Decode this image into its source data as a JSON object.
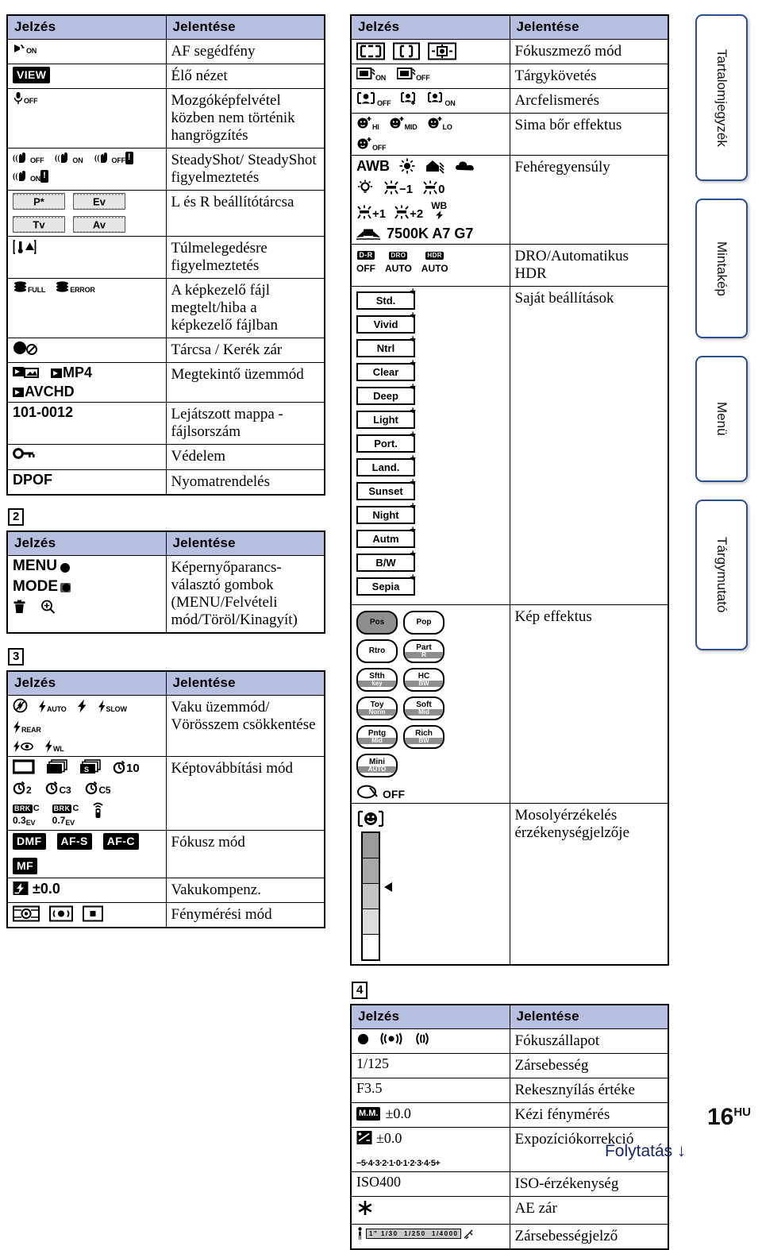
{
  "page": {
    "number": "16",
    "locale_suffix": "HU",
    "continue_label": "Folytatás",
    "continue_arrow": "↓"
  },
  "side_tabs": [
    {
      "label": "Tartalomjegyzék",
      "name": "tab-table-of-contents"
    },
    {
      "label": "Mintakép",
      "name": "tab-sample-photo"
    },
    {
      "label": "Menü",
      "name": "tab-menu"
    },
    {
      "label": "Tárgymutató",
      "name": "tab-index"
    }
  ],
  "column_headers": {
    "symbol": "Jelzés",
    "meaning": "Jelentése"
  },
  "sections": [
    {
      "id": "1",
      "badge_visible": false,
      "column": "left",
      "rows": [
        {
          "symbols": [
            "AF illuminator ON"
          ],
          "meaning": "AF segédfény"
        },
        {
          "symbols": [
            "VIEW"
          ],
          "meaning": "Élő nézet"
        },
        {
          "symbols": [
            "microphone OFF"
          ],
          "meaning": "Mozgóképfelvétel közben nem történik hangrögzítés"
        },
        {
          "symbols": [
            "SteadyShot OFF",
            "SteadyShot ON",
            "SteadyShot OFF warning",
            "SteadyShot ON warning"
          ],
          "meaning": "SteadyShot/ SteadyShot figyelmeztetés"
        },
        {
          "symbols": [
            "P*",
            "Ev",
            "Tv",
            "Av"
          ],
          "meaning": "L és R beállítótárcsa"
        },
        {
          "symbols": [
            "overheat warning"
          ],
          "meaning": "Túlmelegedésre figyelmeztetés"
        },
        {
          "symbols": [
            "database FULL",
            "database ERROR"
          ],
          "meaning": "A képkezelő fájl megtelt/hiba a képkezelő fájlban"
        },
        {
          "symbols": [
            "dial wheel lock"
          ],
          "meaning": "Tárcsa / Kerék zár"
        },
        {
          "symbols": [
            "playback still",
            "playback MP4",
            "playback AVCHD"
          ],
          "meaning": "Megtekintő üzemmód"
        },
        {
          "symbols": [
            "101-0012"
          ],
          "meaning": "Lejátszott mappa - fájlsorszám"
        },
        {
          "symbols": [
            "protect key"
          ],
          "meaning": "Védelem"
        },
        {
          "symbols": [
            "DPOF"
          ],
          "meaning": "Nyomatrendelés"
        }
      ]
    },
    {
      "id": "2",
      "badge_visible": true,
      "column": "left",
      "rows": [
        {
          "symbols": [
            "MENU",
            "MODE",
            "delete",
            "zoom in"
          ],
          "meaning": "Képernyőparancs-választó gombok (MENU/Felvételi mód/Töröl/Kinagyít)"
        }
      ]
    },
    {
      "id": "3",
      "badge_visible": true,
      "column": "left",
      "rows": [
        {
          "symbols": [
            "flash off",
            "flash AUTO",
            "flash fill",
            "flash SLOW",
            "flash REAR",
            "red-eye reduction",
            "flash WL"
          ],
          "meaning": "Vaku üzemmód/ Vörösszem csökkentése"
        },
        {
          "symbols": [
            "single shooting",
            "continuous",
            "speed priority S",
            "self-timer 10",
            "self-timer 2",
            "self-timer C3",
            "self-timer C5",
            "BRK C 0.3EV",
            "BRK C 0.7EV",
            "remote commander"
          ],
          "meaning": "Képtovábbítási mód"
        },
        {
          "symbols": [
            "DMF",
            "AF-S",
            "AF-C",
            "MF"
          ],
          "meaning": "Fókusz mód"
        },
        {
          "symbols": [
            "flash compensation ±0.0"
          ],
          "meaning": "Vakukompenz."
        },
        {
          "symbols": [
            "multi metering",
            "center metering",
            "spot metering"
          ],
          "meaning": "Fénymérési mód"
        }
      ]
    },
    {
      "id": "1r",
      "badge_visible": false,
      "column": "right",
      "rows": [
        {
          "symbols": [
            "wide focus area",
            "zone focus area",
            "flexible spot"
          ],
          "meaning": "Fókuszmező mód"
        },
        {
          "symbols": [
            "object tracking ON",
            "object tracking OFF"
          ],
          "meaning": "Tárgykövetés"
        },
        {
          "symbols": [
            "face detection OFF",
            "face registration",
            "face detection ON"
          ],
          "meaning": "Arcfelismerés"
        },
        {
          "symbols": [
            "soft skin HI",
            "soft skin MID",
            "soft skin LO",
            "soft skin OFF"
          ],
          "meaning": "Sima bőr effektus"
        },
        {
          "symbols": [
            "AWB",
            "daylight",
            "shade",
            "cloudy",
            "incandescent",
            "fluorescent -1",
            "fluorescent 0",
            "fluorescent +1",
            "fluorescent +2",
            "WB flash",
            "custom 7500K A7 G7"
          ],
          "meaning": "Fehéregyensúly"
        },
        {
          "symbols": [
            "D-R OFF",
            "DRO AUTO",
            "HDR AUTO"
          ],
          "meaning": "DRO/Automatikus HDR"
        },
        {
          "symbols": [
            "Std.",
            "Vivid",
            "Ntrl",
            "Clear",
            "Deep",
            "Light",
            "Port.",
            "Land.",
            "Sunset",
            "Night",
            "Autm",
            "B/W",
            "Sepia"
          ],
          "meaning": "Saját beállítások"
        },
        {
          "symbols": [
            "Pos",
            "Pop",
            "Rtro",
            "Part R",
            "Sfth key",
            "HC BW",
            "Toy Norm",
            "Soft Mid",
            "Pntg Mid",
            "Rich BW",
            "Mini AUTO",
            "picture effect OFF"
          ],
          "meaning": "Kép effektus"
        },
        {
          "symbols": [
            "smile detection",
            "smile sensitivity meter"
          ],
          "meaning": "Mosolyérzékelés érzékenységjelzője"
        }
      ]
    },
    {
      "id": "4",
      "badge_visible": true,
      "column": "right",
      "rows": [
        {
          "symbols": [
            "focus locked",
            "focus searching wide",
            "focus searching"
          ],
          "meaning": "Fókuszállapot"
        },
        {
          "symbols": [
            "1/125"
          ],
          "meaning": "Zársebesség"
        },
        {
          "symbols": [
            "F3.5"
          ],
          "meaning": "Rekesznyílás értéke"
        },
        {
          "symbols": [
            "M.M. ±0.0"
          ],
          "meaning": "Kézi fénymérés"
        },
        {
          "symbols": [
            "EV ±0.0",
            "-5·4·3·2·1·0·1·2·3·4·5+"
          ],
          "meaning": "Expozíciókorrekció"
        },
        {
          "symbols": [
            "ISO400"
          ],
          "meaning": "ISO-érzékenység"
        },
        {
          "symbols": [
            "AE lock"
          ],
          "meaning": "AE zár"
        },
        {
          "symbols": [
            "shutter speed scale 1\" 1/30 1/250 1/4000"
          ],
          "meaning": "Zársebességjelző"
        }
      ]
    }
  ],
  "icon_text": {
    "on": "ON",
    "off": "OFF",
    "view": "VIEW",
    "pstar": "P*",
    "ev": "Ev",
    "tv": "Tv",
    "av": "Av",
    "full": "FULL",
    "error": "ERROR",
    "mp4": "MP4",
    "avchd": "AVCHD",
    "folder_file": "101-0012",
    "dpof": "DPOF",
    "menu": "MENU",
    "mode": "MODE",
    "auto": "AUTO",
    "slow": "SLOW",
    "rear": "REAR",
    "wl": "WL",
    "s": "S",
    "t10": "10",
    "t2": "2",
    "c3": "C3",
    "c5": "C5",
    "brk": "BRK",
    "c": "C",
    "ev03": "0.3",
    "ev07": "0.7",
    "evlab": "EV",
    "dmf": "DMF",
    "afs": "AF-S",
    "afc": "AF-C",
    "mf": "MF",
    "pm00": "±0.0",
    "hi": "HI",
    "mid": "MID",
    "lo": "LO",
    "awb": "AWB",
    "wb": "WB",
    "minus1": "−1",
    "zero": "0",
    "plus1": "+1",
    "plus2": "+2",
    "kelvin": "7500K A7 G7",
    "dr": "D-R",
    "dro": "DRO",
    "hdr": "HDR",
    "cs_std": "Std.",
    "cs_vivid": "Vivid",
    "cs_ntrl": "Ntrl",
    "cs_clear": "Clear",
    "cs_deep": "Deep",
    "cs_light": "Light",
    "cs_port": "Port.",
    "cs_land": "Land.",
    "cs_sunset": "Sunset",
    "cs_night": "Night",
    "cs_autm": "Autm",
    "cs_bw": "B/W",
    "cs_sepia": "Sepia",
    "pe_pos": "Pos",
    "pe_pop": "Pop",
    "pe_rtro": "Rtro",
    "pe_part": "Part",
    "pe_part2": "R",
    "pe_sfth": "Sfth",
    "pe_sfth2": "key",
    "pe_hc": "HC",
    "pe_hc2": "BW",
    "pe_toy": "Toy",
    "pe_toy2": "Norm",
    "pe_soft": "Soft",
    "pe_soft2": "Mid",
    "pe_pntg": "Pntg",
    "pe_pntg2": "Mid",
    "pe_rich": "Rich",
    "pe_rich2": "BW",
    "pe_mini": "Mini",
    "pe_mini2": "AUTO",
    "shutter": "1/125",
    "aperture": "F3.5",
    "mm": "M.M.",
    "iso": "ISO400",
    "expscale": "−5·4·3·2·1·0·1·2·3·4·5+",
    "ss_a": "1\"",
    "ss_b": "1/30",
    "ss_c": "1/250",
    "ss_d": "1/4000"
  },
  "colors": {
    "table_header_bg": "#b6bfe0",
    "tab_border": "#2b4f8e",
    "link": "#17256b",
    "border": "#000000"
  }
}
